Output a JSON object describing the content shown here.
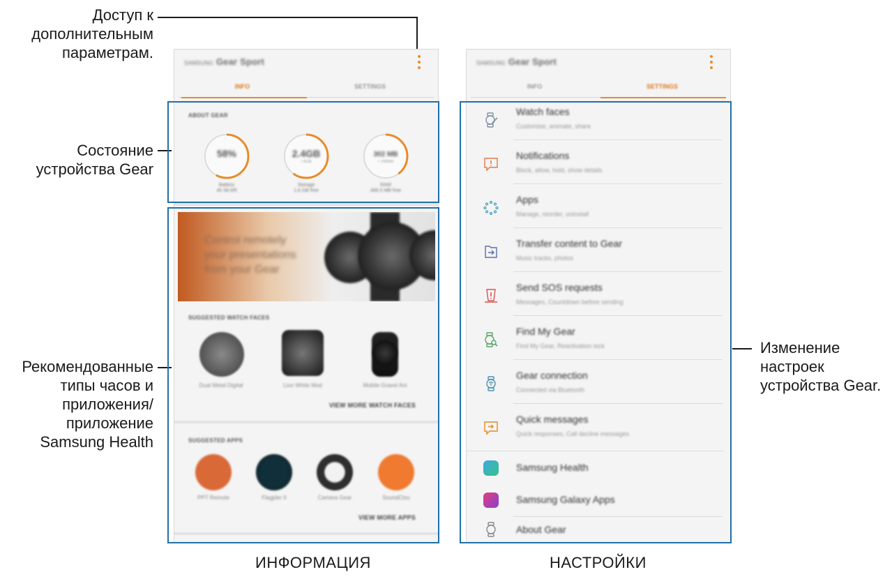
{
  "callouts": {
    "more_options": "Доступ к\nдополнительным\nпараметрам.",
    "gear_status": "Состояние\nустройства Gear",
    "recommended": "Рекомендованные\nтипы часов и\nприложения/\nприложение\nSamsung Health",
    "change_settings": "Изменение\nнастроек\nустройства Gear."
  },
  "captions": {
    "info": "ИНФОРМАЦИЯ",
    "settings": "НАСТРОЙКИ"
  },
  "app": {
    "brand": "SAMSUNG",
    "title": "Gear Sport",
    "tabs": [
      "INFO",
      "SETTINGS"
    ],
    "accent_color": "#e98b28",
    "frame_color": "#1f6fa8"
  },
  "about_gear": {
    "caption": "ABOUT GEAR",
    "gauges": [
      {
        "value": "58%",
        "sub": "",
        "label": "Battery\n4h 58 left",
        "fraction": 0.58
      },
      {
        "value": "2.4GB",
        "sub": "/ 4GB",
        "label": "Storage\n1.6 GB free",
        "fraction": 0.6
      },
      {
        "value": "302 MB",
        "sub": "/ 768MB",
        "label": "RAM\n466.5 MB free",
        "fraction": 0.4
      }
    ]
  },
  "banner": {
    "text": "Control remotely\nyour presentations\nfrom your Gear"
  },
  "watch_faces": {
    "caption": "SUGGESTED WATCH FACES",
    "items": [
      "Dual Metal Digital",
      "Lion White Mod",
      "Mobile Gravel Ani"
    ],
    "more": "VIEW MORE WATCH FACES"
  },
  "apps": {
    "caption": "SUGGESTED APPS",
    "items": [
      "PPT Remote",
      "Flagpler II",
      "Camera Gear",
      "SoundClou"
    ],
    "more": "VIEW MORE APPS"
  },
  "settings_list": [
    {
      "title": "Watch faces",
      "sub": "Customise, animate, share",
      "icon": "watch-face-edit-icon"
    },
    {
      "title": "Notifications",
      "sub": "Block, allow, hold, show details",
      "icon": "notification-icon"
    },
    {
      "title": "Apps",
      "sub": "Manage, reorder, uninstall",
      "icon": "apps-grid-icon"
    },
    {
      "title": "Transfer content to Gear",
      "sub": "Music tracks, photos",
      "icon": "transfer-icon"
    },
    {
      "title": "Send SOS requests",
      "sub": "Messages, Countdown before sending",
      "icon": "sos-icon"
    },
    {
      "title": "Find My Gear",
      "sub": "Find My Gear, Reactivation lock",
      "icon": "find-gear-icon"
    },
    {
      "title": "Gear connection",
      "sub": "Connected via Bluetooth",
      "icon": "gear-connection-icon"
    },
    {
      "title": "Quick messages",
      "sub": "Quick responses, Call decline messages",
      "icon": "quick-messages-icon"
    },
    {
      "title": "Samsung Health",
      "sub": "",
      "icon": "samsung-health-icon"
    },
    {
      "title": "Samsung Galaxy Apps",
      "sub": "",
      "icon": "galaxy-apps-icon"
    },
    {
      "title": "About Gear",
      "sub": "",
      "icon": "about-gear-icon"
    }
  ]
}
